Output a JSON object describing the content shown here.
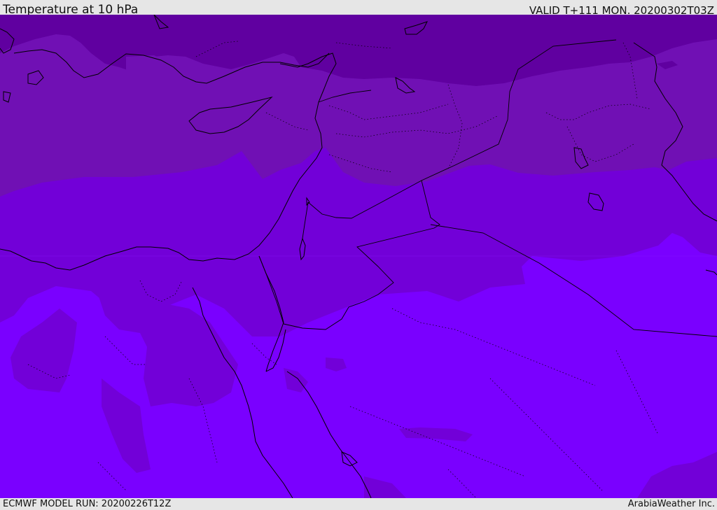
{
  "header": {
    "title": "Temperature at 10 hPa",
    "valid": "VALID T+111 MON. 20200302T03Z"
  },
  "footer": {
    "model_run": "ECMWF MODEL RUN: 20200226T12Z",
    "brand": "ArabiaWeather Inc."
  },
  "map": {
    "field": "Temperature",
    "level": "10 hPa",
    "colors": {
      "band_darkest": "#6000a0",
      "band_dark": "#7010b4",
      "band_mid": "#7200d8",
      "band_light": "#7800f0",
      "band_lightest": "#7a00ff",
      "coastline": "#000000"
    }
  }
}
